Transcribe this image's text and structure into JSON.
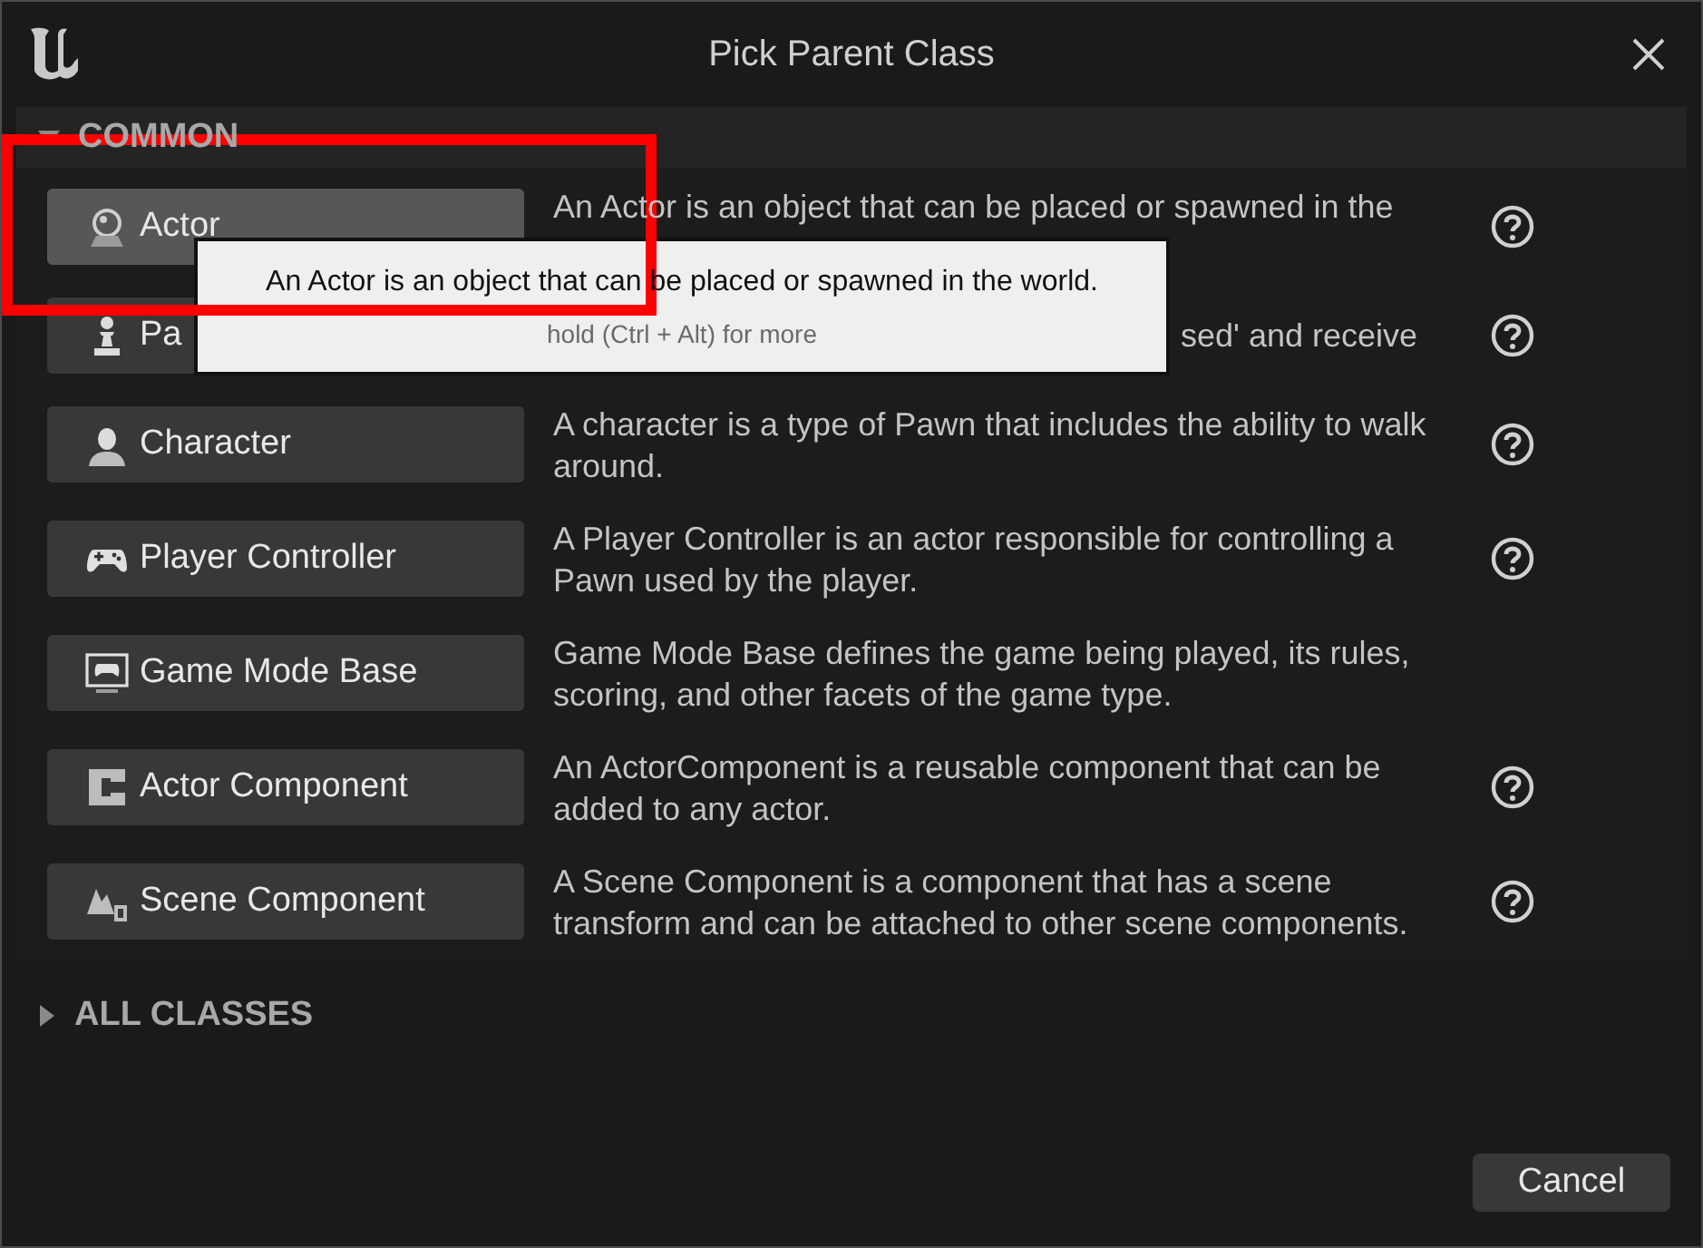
{
  "window": {
    "title": "Pick Parent Class"
  },
  "common": {
    "label": "COMMON",
    "expanded": true,
    "rows": [
      {
        "kind": "actor",
        "label": "Actor",
        "description": "An Actor is an object that can be placed or spawned in the",
        "hovered": true,
        "help": true,
        "desc_offset": false
      },
      {
        "kind": "pawn",
        "label": "Pa",
        "description": "sed' and receive",
        "hovered": false,
        "help": true,
        "desc_offset": true
      },
      {
        "kind": "character",
        "label": "Character",
        "description": "A character is a type of Pawn that includes the ability to walk around.",
        "hovered": false,
        "help": true,
        "desc_offset": false
      },
      {
        "kind": "controller",
        "label": "Player Controller",
        "description": "A Player Controller is an actor responsible for controlling a Pawn used by the player.",
        "hovered": false,
        "help": true,
        "desc_offset": false
      },
      {
        "kind": "gamemode",
        "label": "Game Mode Base",
        "description": "Game Mode Base defines the game being played, its rules, scoring, and other facets of the game type.",
        "hovered": false,
        "help": false,
        "desc_offset": false
      },
      {
        "kind": "component",
        "label": "Actor Component",
        "description": "An ActorComponent is a reusable component that can be added to any actor.",
        "hovered": false,
        "help": true,
        "desc_offset": false
      },
      {
        "kind": "scene",
        "label": "Scene Component",
        "description": "A Scene Component is a component that has a scene transform and can be attached to other scene components.",
        "hovered": false,
        "help": true,
        "desc_offset": false
      }
    ]
  },
  "all_classes": {
    "label": "ALL CLASSES",
    "expanded": false
  },
  "tooltip": {
    "text": "An Actor is an object that can be placed or spawned in the world.",
    "hint": "hold (Ctrl + Alt) for more"
  },
  "highlight": {
    "kind": "frame"
  },
  "buttons": [
    "Cancel"
  ]
}
